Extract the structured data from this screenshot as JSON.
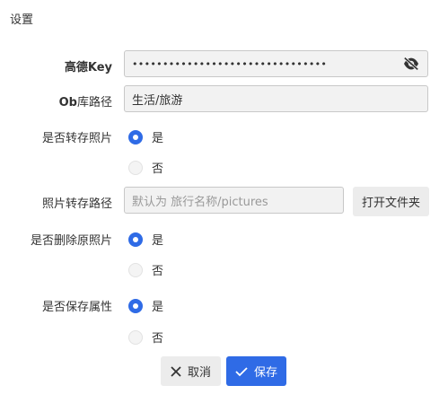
{
  "window": {
    "title": "设置"
  },
  "form": {
    "key": {
      "label_bold": "高德Key",
      "value": "••••••••••••••••••••••••••••••••"
    },
    "path": {
      "label_bold": "Ob",
      "label_plain": "库路径",
      "value": "生活/旅游"
    },
    "transfer_photos": {
      "label": "是否转存照片",
      "yes": "是",
      "no": "否",
      "selected": "是"
    },
    "photo_path": {
      "label": "照片转存路径",
      "placeholder": "默认为 旅行名称/pictures",
      "open_button": "打开文件夹"
    },
    "delete_original": {
      "label": "是否删除原照片",
      "yes": "是",
      "no": "否",
      "selected": "是"
    },
    "save_attributes": {
      "label": "是否保存属性",
      "yes": "是",
      "no": "否",
      "selected": "是"
    }
  },
  "actions": {
    "cancel": "取消",
    "save": "保存"
  },
  "colors": {
    "accent": "#2f6be6",
    "field_bg": "#f2f2f2",
    "button_bg": "#ececec"
  },
  "icons": {
    "toggle_visibility": "eye-slash-icon",
    "cancel": "close-icon",
    "save": "check-icon"
  }
}
